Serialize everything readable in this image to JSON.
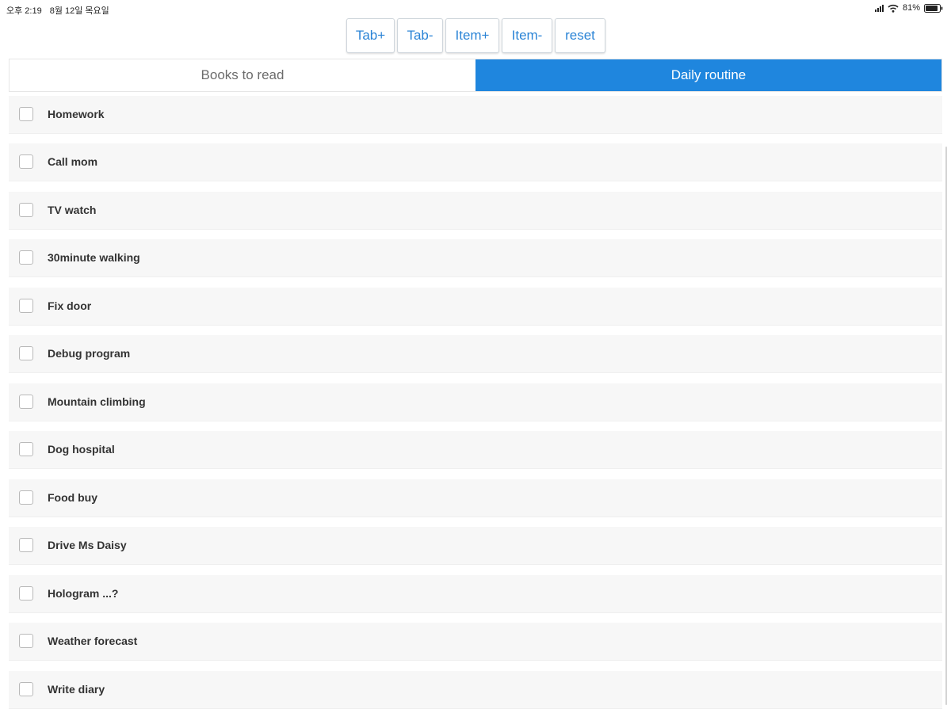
{
  "status_bar": {
    "time": "오후 2:19",
    "date": "8월 12일 목요일",
    "battery_percent": "81%"
  },
  "toolbar": {
    "tab_add": "Tab+",
    "tab_remove": "Tab-",
    "item_add": "Item+",
    "item_remove": "Item-",
    "reset": "reset"
  },
  "tabs": [
    {
      "label": "Books to read",
      "active": false
    },
    {
      "label": "Daily routine",
      "active": true
    }
  ],
  "items": [
    {
      "label": "Homework",
      "checked": false
    },
    {
      "label": "Call mom",
      "checked": false
    },
    {
      "label": "TV watch",
      "checked": false
    },
    {
      "label": "30minute walking",
      "checked": false
    },
    {
      "label": "Fix door",
      "checked": false
    },
    {
      "label": "Debug program",
      "checked": false
    },
    {
      "label": "Mountain climbing",
      "checked": false
    },
    {
      "label": "Dog hospital",
      "checked": false
    },
    {
      "label": "Food buy",
      "checked": false
    },
    {
      "label": "Drive Ms Daisy",
      "checked": false
    },
    {
      "label": "Hologram ...?",
      "checked": false
    },
    {
      "label": "Weather forecast",
      "checked": false
    },
    {
      "label": "Write diary",
      "checked": false
    }
  ],
  "colors": {
    "accent": "#1f86de",
    "button_text": "#2b84d6",
    "row_background": "#f7f7f7"
  }
}
